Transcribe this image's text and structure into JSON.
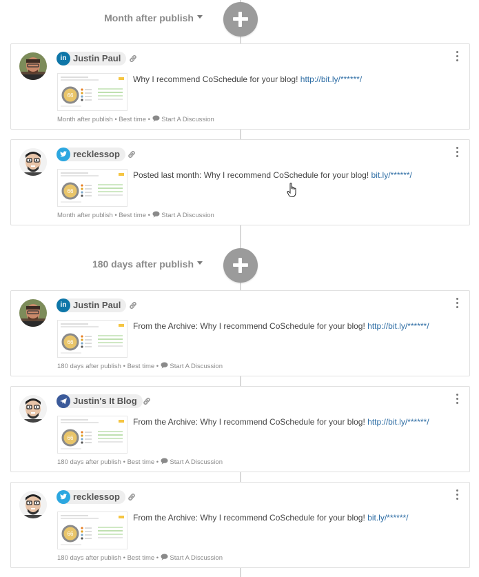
{
  "groups": [
    {
      "label": "Month after publish",
      "posts": [
        {
          "network": "linkedin",
          "account": "Justin Paul",
          "message": "Why I recommend CoSchedule for your blog!",
          "link": "http://bit.ly/******/",
          "timing": "Month after publish",
          "best_time": "Best time",
          "discussion": "Start A Discussion"
        },
        {
          "network": "twitter",
          "account": "recklessop",
          "message": "Posted last month: Why I recommend CoSchedule for your blog!",
          "link": "bit.ly/******/",
          "timing": "Month after publish",
          "best_time": "Best time",
          "discussion": "Start A Discussion"
        }
      ]
    },
    {
      "label": "180 days after publish",
      "posts": [
        {
          "network": "linkedin",
          "account": "Justin Paul",
          "message": "From the Archive: Why I recommend CoSchedule for your blog!",
          "link": "http://bit.ly/******/",
          "timing": "180 days after publish",
          "best_time": "Best time",
          "discussion": "Start A Discussion"
        },
        {
          "network": "blog",
          "account": "Justin's It Blog",
          "message": "From the Archive: Why I recommend CoSchedule for your blog!",
          "link": "http://bit.ly/******/",
          "timing": "180 days after publish",
          "best_time": "Best time",
          "discussion": "Start A Discussion"
        },
        {
          "network": "twitter",
          "account": "recklessop",
          "message": "From the Archive: Why I recommend CoSchedule for your blog!",
          "link": "bit.ly/******/",
          "timing": "180 days after publish",
          "best_time": "Best time",
          "discussion": "Start A Discussion"
        }
      ]
    }
  ],
  "icons": {
    "add": "plus-icon",
    "more": "kebab-menu-icon",
    "link": "chain-link-icon",
    "discussion": "speech-bubble-icon",
    "caret": "caret-down-icon"
  },
  "colors": {
    "linkedin": "#0e76a8",
    "twitter": "#2ca7e0",
    "blog": "#3b5a9a",
    "link": "#2e6da4",
    "add_button": "#9b9b9b"
  },
  "thumbnail": {
    "score": "66"
  }
}
